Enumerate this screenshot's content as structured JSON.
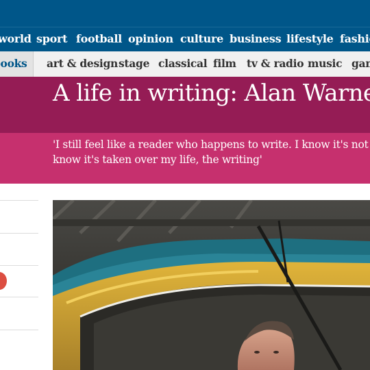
{
  "nav": {
    "items": [
      "world",
      "sport",
      "football",
      "opinion",
      "culture",
      "business",
      "lifestyle",
      "fashion"
    ]
  },
  "subnav": {
    "active": "books",
    "items": [
      "art & design",
      "stage",
      "classical",
      "film",
      "tv & radio",
      "music",
      "games"
    ]
  },
  "article": {
    "headline": "A life in writing: Alan Warner",
    "standfirst_line1": "'I still feel like a reader who happens to write. I know it's not re",
    "standfirst_line2": "know it's taken over my life, the writing'"
  },
  "colors": {
    "brand_blue": "#005689",
    "culture_dark": "#951c55",
    "culture_light": "#c6306e"
  },
  "icons": [
    "share-icon"
  ]
}
